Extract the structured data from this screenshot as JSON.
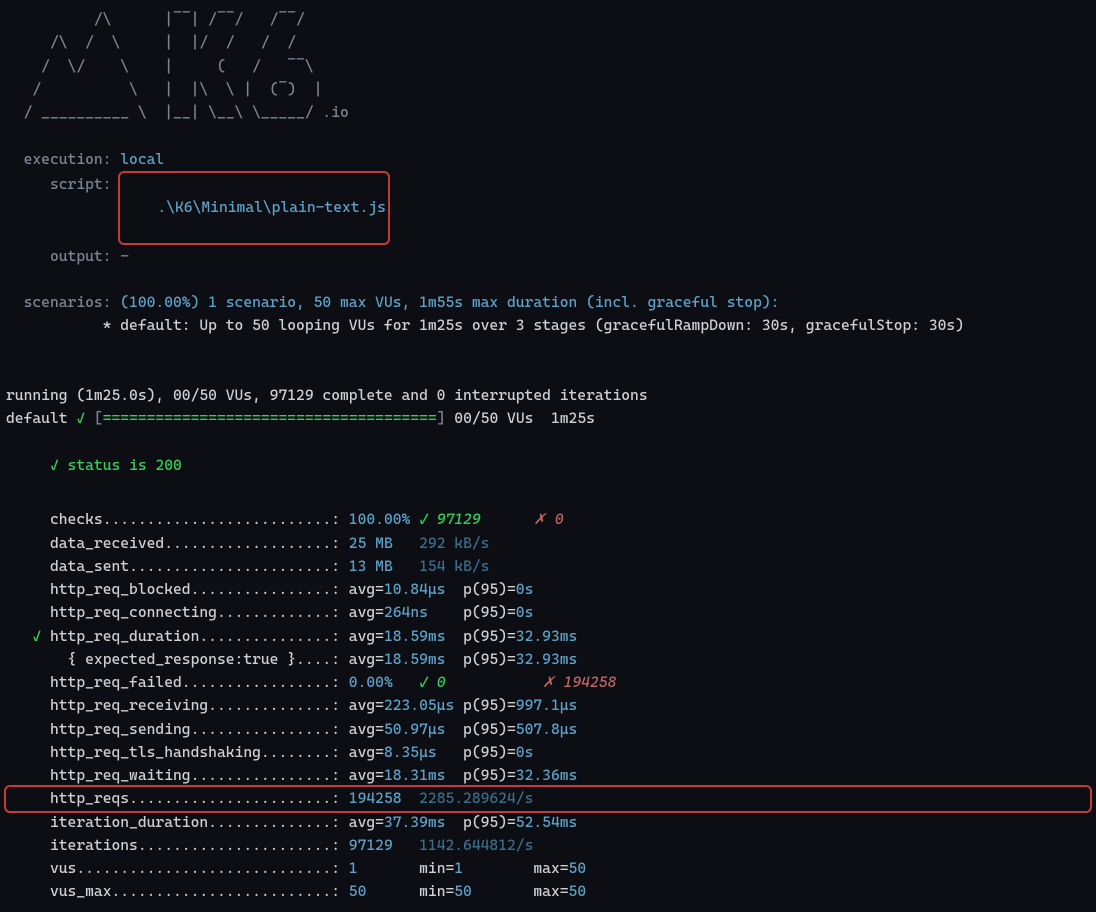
{
  "logo": [
    "          /\\      |‾‾| /‾‾/   /‾‾/   ",
    "     /\\  /  \\     |  |/  /   /  /    ",
    "    /  \\/    \\    |     (   /   ‾‾\\  ",
    "   /          \\   |  |\\  \\ |  (‾)  | ",
    "  / __________ \\  |__| \\__\\ \\_____/ .io"
  ],
  "header": {
    "execution_label": "  execution:",
    "execution_value": "local",
    "script_label": "     script:",
    "script_value": ".\\K6\\Minimal\\plain-text.js",
    "output_label": "     output:",
    "output_value": "-",
    "scenarios_label": "  scenarios:",
    "scenarios_value": "(100.00%) 1 scenario, 50 max VUs, 1m55s max duration (incl. graceful stop):",
    "scenarios_line2": "           * default: Up to 50 looping VUs for 1m25s over 3 stages (gracefulRampDown: 30s, gracefulStop: 30s)"
  },
  "progress": {
    "running_line": "running (1m25.0s), 00/50 VUs, 97129 complete and 0 interrupted iterations",
    "default_label": "default",
    "check_mark": "✓",
    "bar_filled": "======================================",
    "vus_info": "00/50 VUs  1m25s"
  },
  "status_check": {
    "mark": "✓",
    "text": "status is 200"
  },
  "label_col_width": 32,
  "metrics": [
    {
      "indent": "     ",
      "label": "checks",
      "tail": [
        {
          "t": "100.00%",
          "c": "v-blue"
        },
        {
          "t": " ",
          "c": "v-gray"
        },
        {
          "t": "✓ 97129",
          "c": "i-green"
        },
        {
          "t": "      ",
          "c": "v-gray"
        },
        {
          "t": "✗ 0",
          "c": "red-x"
        }
      ]
    },
    {
      "indent": "     ",
      "label": "data_received",
      "tail": [
        {
          "t": "25 MB",
          "c": "v-blue"
        },
        {
          "t": "   ",
          "c": "v-gray"
        },
        {
          "t": "292 kB/s",
          "c": "v-blue2"
        }
      ]
    },
    {
      "indent": "     ",
      "label": "data_sent",
      "tail": [
        {
          "t": "13 MB",
          "c": "v-blue"
        },
        {
          "t": "   ",
          "c": "v-gray"
        },
        {
          "t": "154 kB/s",
          "c": "v-blue2"
        }
      ]
    },
    {
      "indent": "     ",
      "label": "http_req_blocked",
      "tail": [
        {
          "t": "avg=",
          "c": "v-gray"
        },
        {
          "t": "10.84µs",
          "c": "v-blue"
        },
        {
          "t": "  p(95)=",
          "c": "v-gray"
        },
        {
          "t": "0s",
          "c": "v-blue"
        }
      ]
    },
    {
      "indent": "     ",
      "label": "http_req_connecting",
      "tail": [
        {
          "t": "avg=",
          "c": "v-gray"
        },
        {
          "t": "264ns",
          "c": "v-blue"
        },
        {
          "t": "    p(95)=",
          "c": "v-gray"
        },
        {
          "t": "0s",
          "c": "v-blue"
        }
      ]
    },
    {
      "indent": "   ",
      "check": "✓ ",
      "label": "http_req_duration",
      "tail": [
        {
          "t": "avg=",
          "c": "v-gray"
        },
        {
          "t": "18.59ms",
          "c": "v-blue"
        },
        {
          "t": "  p(95)=",
          "c": "v-gray"
        },
        {
          "t": "32.93ms",
          "c": "v-blue"
        }
      ]
    },
    {
      "indent": "       ",
      "label": "{ expected_response:true }",
      "tail": [
        {
          "t": "avg=",
          "c": "v-gray"
        },
        {
          "t": "18.59ms",
          "c": "v-blue"
        },
        {
          "t": "  p(95)=",
          "c": "v-gray"
        },
        {
          "t": "32.93ms",
          "c": "v-blue"
        }
      ]
    },
    {
      "indent": "     ",
      "label": "http_req_failed",
      "tail": [
        {
          "t": "0.00%",
          "c": "v-blue"
        },
        {
          "t": "   ",
          "c": "v-gray"
        },
        {
          "t": "✓ 0",
          "c": "i-green"
        },
        {
          "t": "           ",
          "c": "v-gray"
        },
        {
          "t": "✗ 194258",
          "c": "red-x"
        }
      ]
    },
    {
      "indent": "     ",
      "label": "http_req_receiving",
      "tail": [
        {
          "t": "avg=",
          "c": "v-gray"
        },
        {
          "t": "223.05µs",
          "c": "v-blue"
        },
        {
          "t": " p(95)=",
          "c": "v-gray"
        },
        {
          "t": "997.1µs",
          "c": "v-blue"
        }
      ]
    },
    {
      "indent": "     ",
      "label": "http_req_sending",
      "tail": [
        {
          "t": "avg=",
          "c": "v-gray"
        },
        {
          "t": "50.97µs",
          "c": "v-blue"
        },
        {
          "t": "  p(95)=",
          "c": "v-gray"
        },
        {
          "t": "507.8µs",
          "c": "v-blue"
        }
      ]
    },
    {
      "indent": "     ",
      "label": "http_req_tls_handshaking",
      "tail": [
        {
          "t": "avg=",
          "c": "v-gray"
        },
        {
          "t": "8.35µs",
          "c": "v-blue"
        },
        {
          "t": "   p(95)=",
          "c": "v-gray"
        },
        {
          "t": "0s",
          "c": "v-blue"
        }
      ]
    },
    {
      "indent": "     ",
      "label": "http_req_waiting",
      "tail": [
        {
          "t": "avg=",
          "c": "v-gray"
        },
        {
          "t": "18.31ms",
          "c": "v-blue"
        },
        {
          "t": "  p(95)=",
          "c": "v-gray"
        },
        {
          "t": "32.36ms",
          "c": "v-blue"
        }
      ]
    },
    {
      "indent": "     ",
      "label": "http_reqs",
      "highlight": true,
      "tail": [
        {
          "t": "194258",
          "c": "v-blue"
        },
        {
          "t": "  ",
          "c": "v-gray"
        },
        {
          "t": "2285.289624/s",
          "c": "v-blue2"
        }
      ]
    },
    {
      "indent": "     ",
      "label": "iteration_duration",
      "tail": [
        {
          "t": "avg=",
          "c": "v-gray"
        },
        {
          "t": "37.39ms",
          "c": "v-blue"
        },
        {
          "t": "  p(95)=",
          "c": "v-gray"
        },
        {
          "t": "52.54ms",
          "c": "v-blue"
        }
      ]
    },
    {
      "indent": "     ",
      "label": "iterations",
      "tail": [
        {
          "t": "97129",
          "c": "v-blue"
        },
        {
          "t": "   ",
          "c": "v-gray"
        },
        {
          "t": "1142.644812/s",
          "c": "v-blue2"
        }
      ]
    },
    {
      "indent": "     ",
      "label": "vus",
      "tail": [
        {
          "t": "1",
          "c": "v-blue"
        },
        {
          "t": "       min=",
          "c": "v-gray"
        },
        {
          "t": "1",
          "c": "v-blue"
        },
        {
          "t": "        max=",
          "c": "v-gray"
        },
        {
          "t": "50",
          "c": "v-blue"
        }
      ]
    },
    {
      "indent": "     ",
      "label": "vus_max",
      "tail": [
        {
          "t": "50",
          "c": "v-blue"
        },
        {
          "t": "      min=",
          "c": "v-gray"
        },
        {
          "t": "50",
          "c": "v-blue"
        },
        {
          "t": "       max=",
          "c": "v-gray"
        },
        {
          "t": "50",
          "c": "v-blue"
        }
      ]
    }
  ]
}
